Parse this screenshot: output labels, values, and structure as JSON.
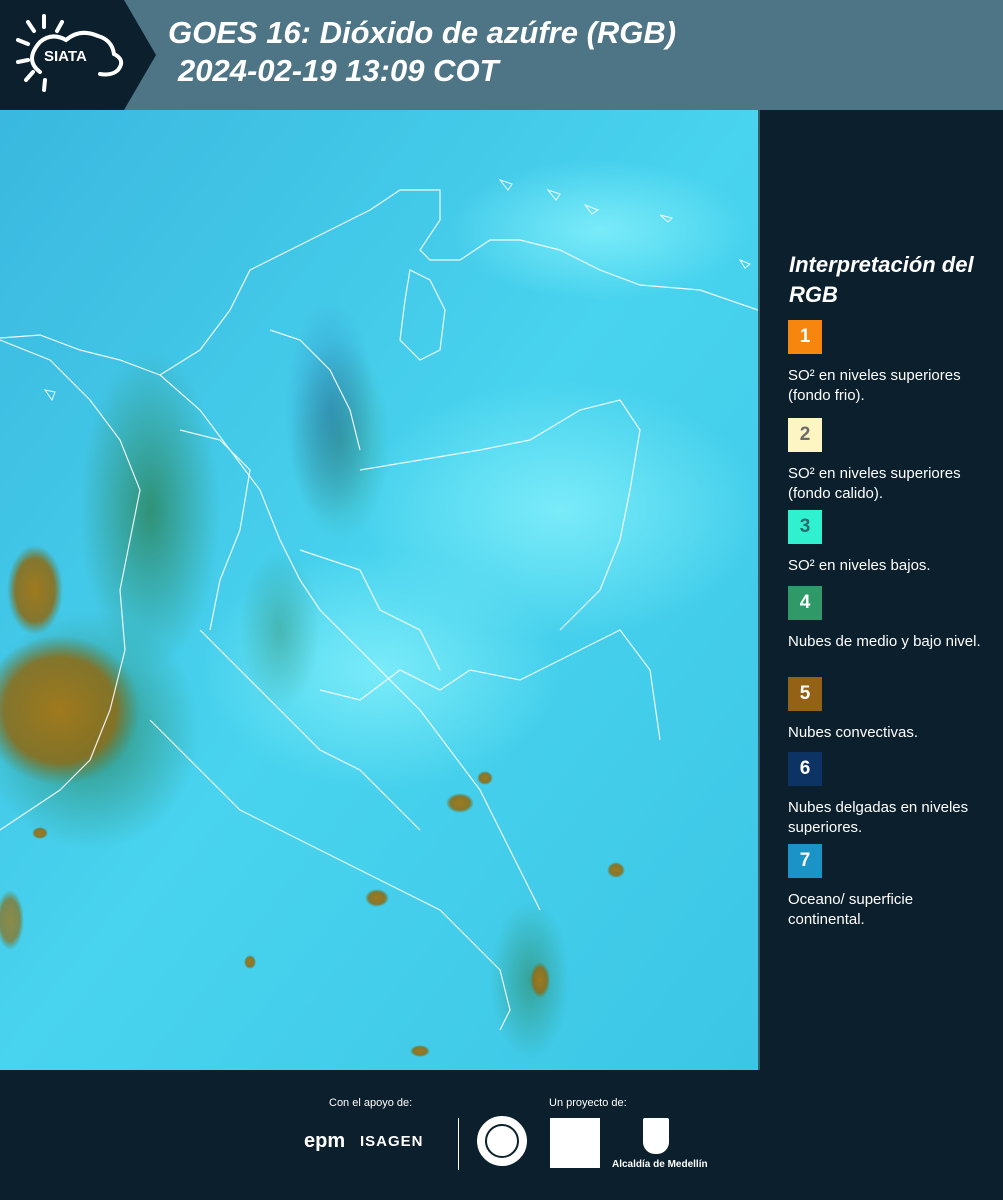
{
  "header": {
    "logo_text": "SIATA",
    "title_line1": "GOES 16: Dióxido de azúfre (RGB)",
    "title_line2": "2024-02-19 13:09 COT"
  },
  "legend": {
    "title": "Interpretación del RGB",
    "items": [
      {
        "number": "1",
        "label": "SO² en niveles superiores (fondo frio).",
        "color": "#f7860f",
        "text_color": "#ffffff"
      },
      {
        "number": "2",
        "label": "SO² en niveles superiores (fondo calido).",
        "color": "#fdf6c3",
        "text_color": "#6b6b6b"
      },
      {
        "number": "3",
        "label": "SO² en niveles bajos.",
        "color": "#2ff0cf",
        "text_color": "#2a6b70"
      },
      {
        "number": "4",
        "label": "Nubes de medio y bajo nivel.",
        "color": "#2f9a68",
        "text_color": "#ffffff"
      },
      {
        "number": "5",
        "label": "Nubes convectivas.",
        "color": "#946214",
        "text_color": "#ffffff"
      },
      {
        "number": "6",
        "label": "Nubes delgadas en niveles superiores.",
        "color": "#0c3364",
        "text_color": "#ffffff"
      },
      {
        "number": "7",
        "label": "Oceano/ superficie continental.",
        "color": "#1a94c6",
        "text_color": "#ffffff"
      }
    ]
  },
  "footer": {
    "support_caption": "Con el apoyo de:",
    "support_logos": [
      "epm",
      "ISAGEN"
    ],
    "project_caption": "Un proyecto de:",
    "alcaldia_text": "Alcaldía de Medellín"
  }
}
